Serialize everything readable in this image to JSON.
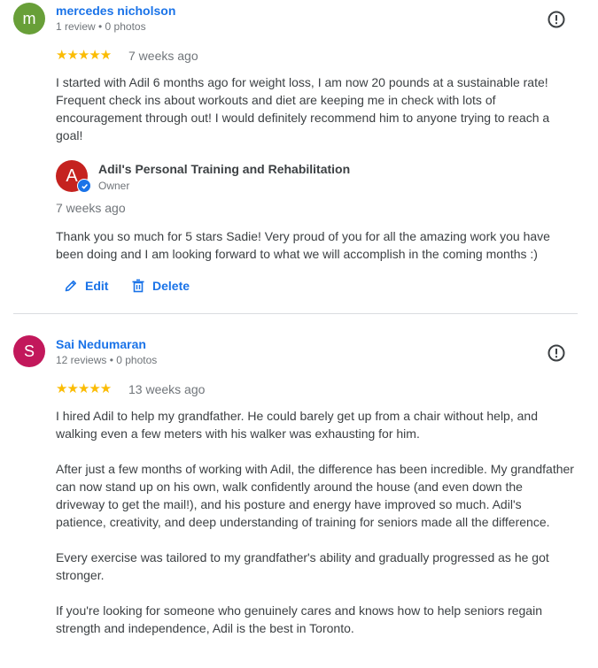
{
  "reviews": [
    {
      "avatar_letter": "m",
      "avatar_color": "#689f38",
      "name": "mercedes nicholson",
      "meta": "1 review • 0 photos",
      "stars": "★★★★★",
      "rating": 5,
      "time": "7 weeks ago",
      "text": "I started with Adil 6 months ago for weight loss, I am now 20 pounds at a sustainable rate! Frequent check ins about workouts and diet are keeping me in check with lots of encouragement through out! I would definitely recommend him to anyone trying to reach a goal!",
      "owner_reply": {
        "avatar_letter": "A",
        "name": "Adil's Personal Training and Rehabilitation",
        "role": "Owner",
        "time": "7 weeks ago",
        "text": "Thank you so much for 5 stars Sadie! Very proud of you for all the amazing work you have been doing and I am looking forward to what we will accomplish in the coming months :)",
        "edit_label": "Edit",
        "delete_label": "Delete"
      }
    },
    {
      "avatar_letter": "S",
      "avatar_color": "#c2185b",
      "name": "Sai Nedumaran",
      "meta": "12 reviews • 0 photos",
      "stars": "★★★★★",
      "rating": 5,
      "time": "13 weeks ago",
      "text": "I hired Adil to help my grandfather. He could barely get up from a chair without help, and walking even a few meters with his walker was exhausting for him.\n\nAfter just a few months of working with Adil, the difference has been incredible. My grandfather can now stand up on his own, walk confidently around the house (and even down the driveway to get the mail!), and his posture and energy have improved so much. Adil's patience, creativity, and deep understanding of training for seniors made all the difference.\n\nEvery exercise was tailored to my grandfather's ability and gradually progressed as he got stronger.\n\nIf you're looking for someone who genuinely cares and knows how to help seniors regain strength and independence, Adil is the best in Toronto."
    }
  ],
  "icons": {
    "flag": "report-flag-icon",
    "edit": "pencil-icon",
    "delete": "trash-icon",
    "verified": "verified-check-icon"
  }
}
